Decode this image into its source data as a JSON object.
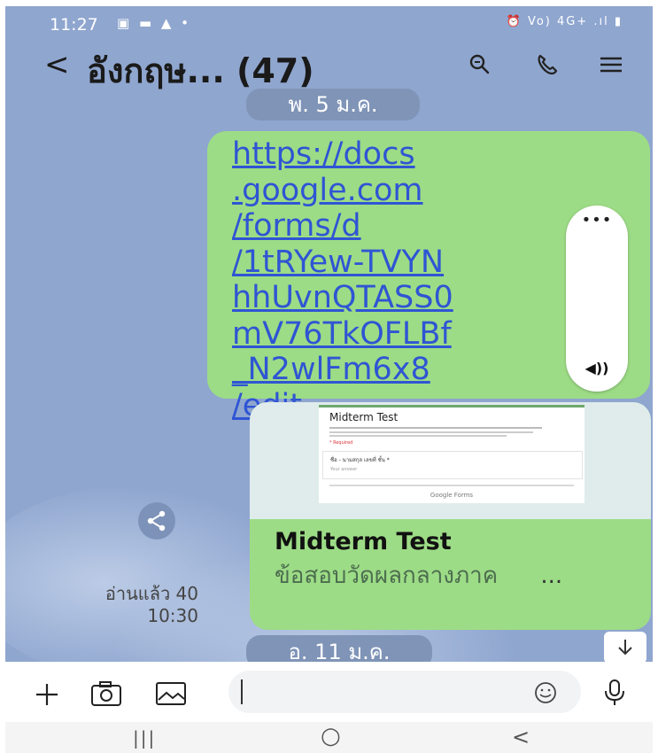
{
  "status_bar": {
    "time": "11:27",
    "left_icons": "▣ ▬ ▲ •",
    "right_icons": "⏰ Vo) 4G+ .ıl ▮",
    "network": "4G+"
  },
  "header": {
    "back_glyph": "<",
    "title": "อังกฤษ... (47)"
  },
  "date_chips": [
    "พ. 5 ม.ค.",
    "อ. 11 ม.ค."
  ],
  "link_message": {
    "lines": [
      "https://docs",
      ".google.com",
      "/forms/d",
      "/1tRYew-TVYN",
      "hhUvnQTASS0",
      "mV76TkOFLBf",
      "_N2wlFm6x8",
      "/edit"
    ]
  },
  "volume_panel": {
    "menu_glyph": "•••",
    "speaker_glyph": "◀))"
  },
  "form_card": {
    "preview": {
      "form_title": "Midterm Test",
      "required_note": "* Required",
      "question": "ชื่อ - นามสกุล เลขที่ ชั้น *",
      "answer_placeholder": "Your answer",
      "brand": "Google Forms"
    },
    "title": "Midterm Test",
    "description": "ข้อสอบวัดผลกลางภาค",
    "more": "..."
  },
  "read_status": {
    "label": "อ่านแล้ว 40",
    "time": "10:30"
  },
  "input_bar": {
    "placeholder": ""
  },
  "nav": {
    "recent": "|||",
    "home": "○",
    "back": "<"
  }
}
